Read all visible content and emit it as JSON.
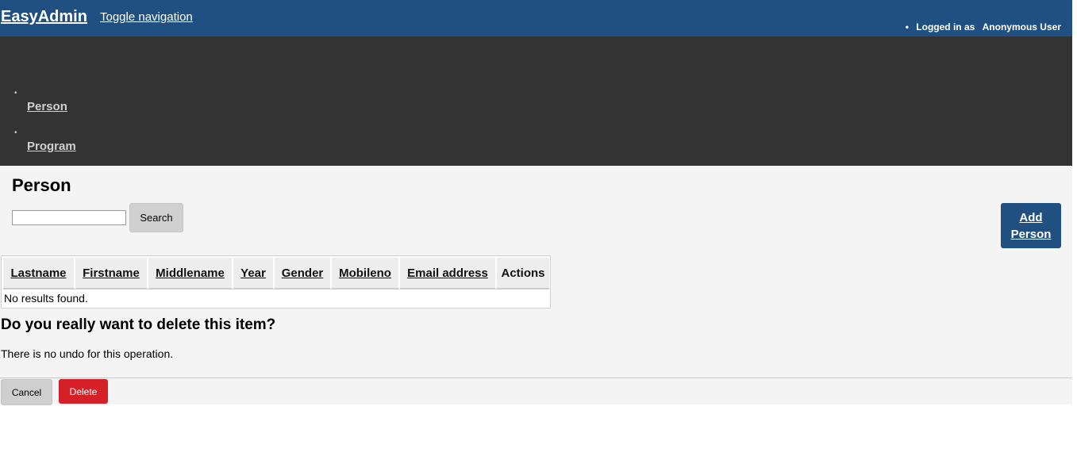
{
  "header": {
    "brand": "EasyAdmin",
    "toggle": "Toggle navigation",
    "logged_in_label": "Logged in as",
    "user_name": "Anonymous User"
  },
  "sidebar": {
    "items": [
      {
        "label": "Person"
      },
      {
        "label": "Program"
      }
    ]
  },
  "main": {
    "title": "Person",
    "search": {
      "value": "",
      "button": "Search"
    },
    "add_button": "Add Person",
    "table": {
      "columns": [
        "Lastname",
        "Firstname",
        "Middlename",
        "Year",
        "Gender",
        "Mobileno",
        "Email address",
        "Actions"
      ],
      "empty_message": "No results found."
    }
  },
  "modal": {
    "title": "Do you really want to delete this item?",
    "body": "There is no undo for this operation.",
    "cancel": "Cancel",
    "delete": "Delete"
  },
  "colors": {
    "brand": "#205081",
    "sidebar": "#333333",
    "danger": "#d62027"
  }
}
